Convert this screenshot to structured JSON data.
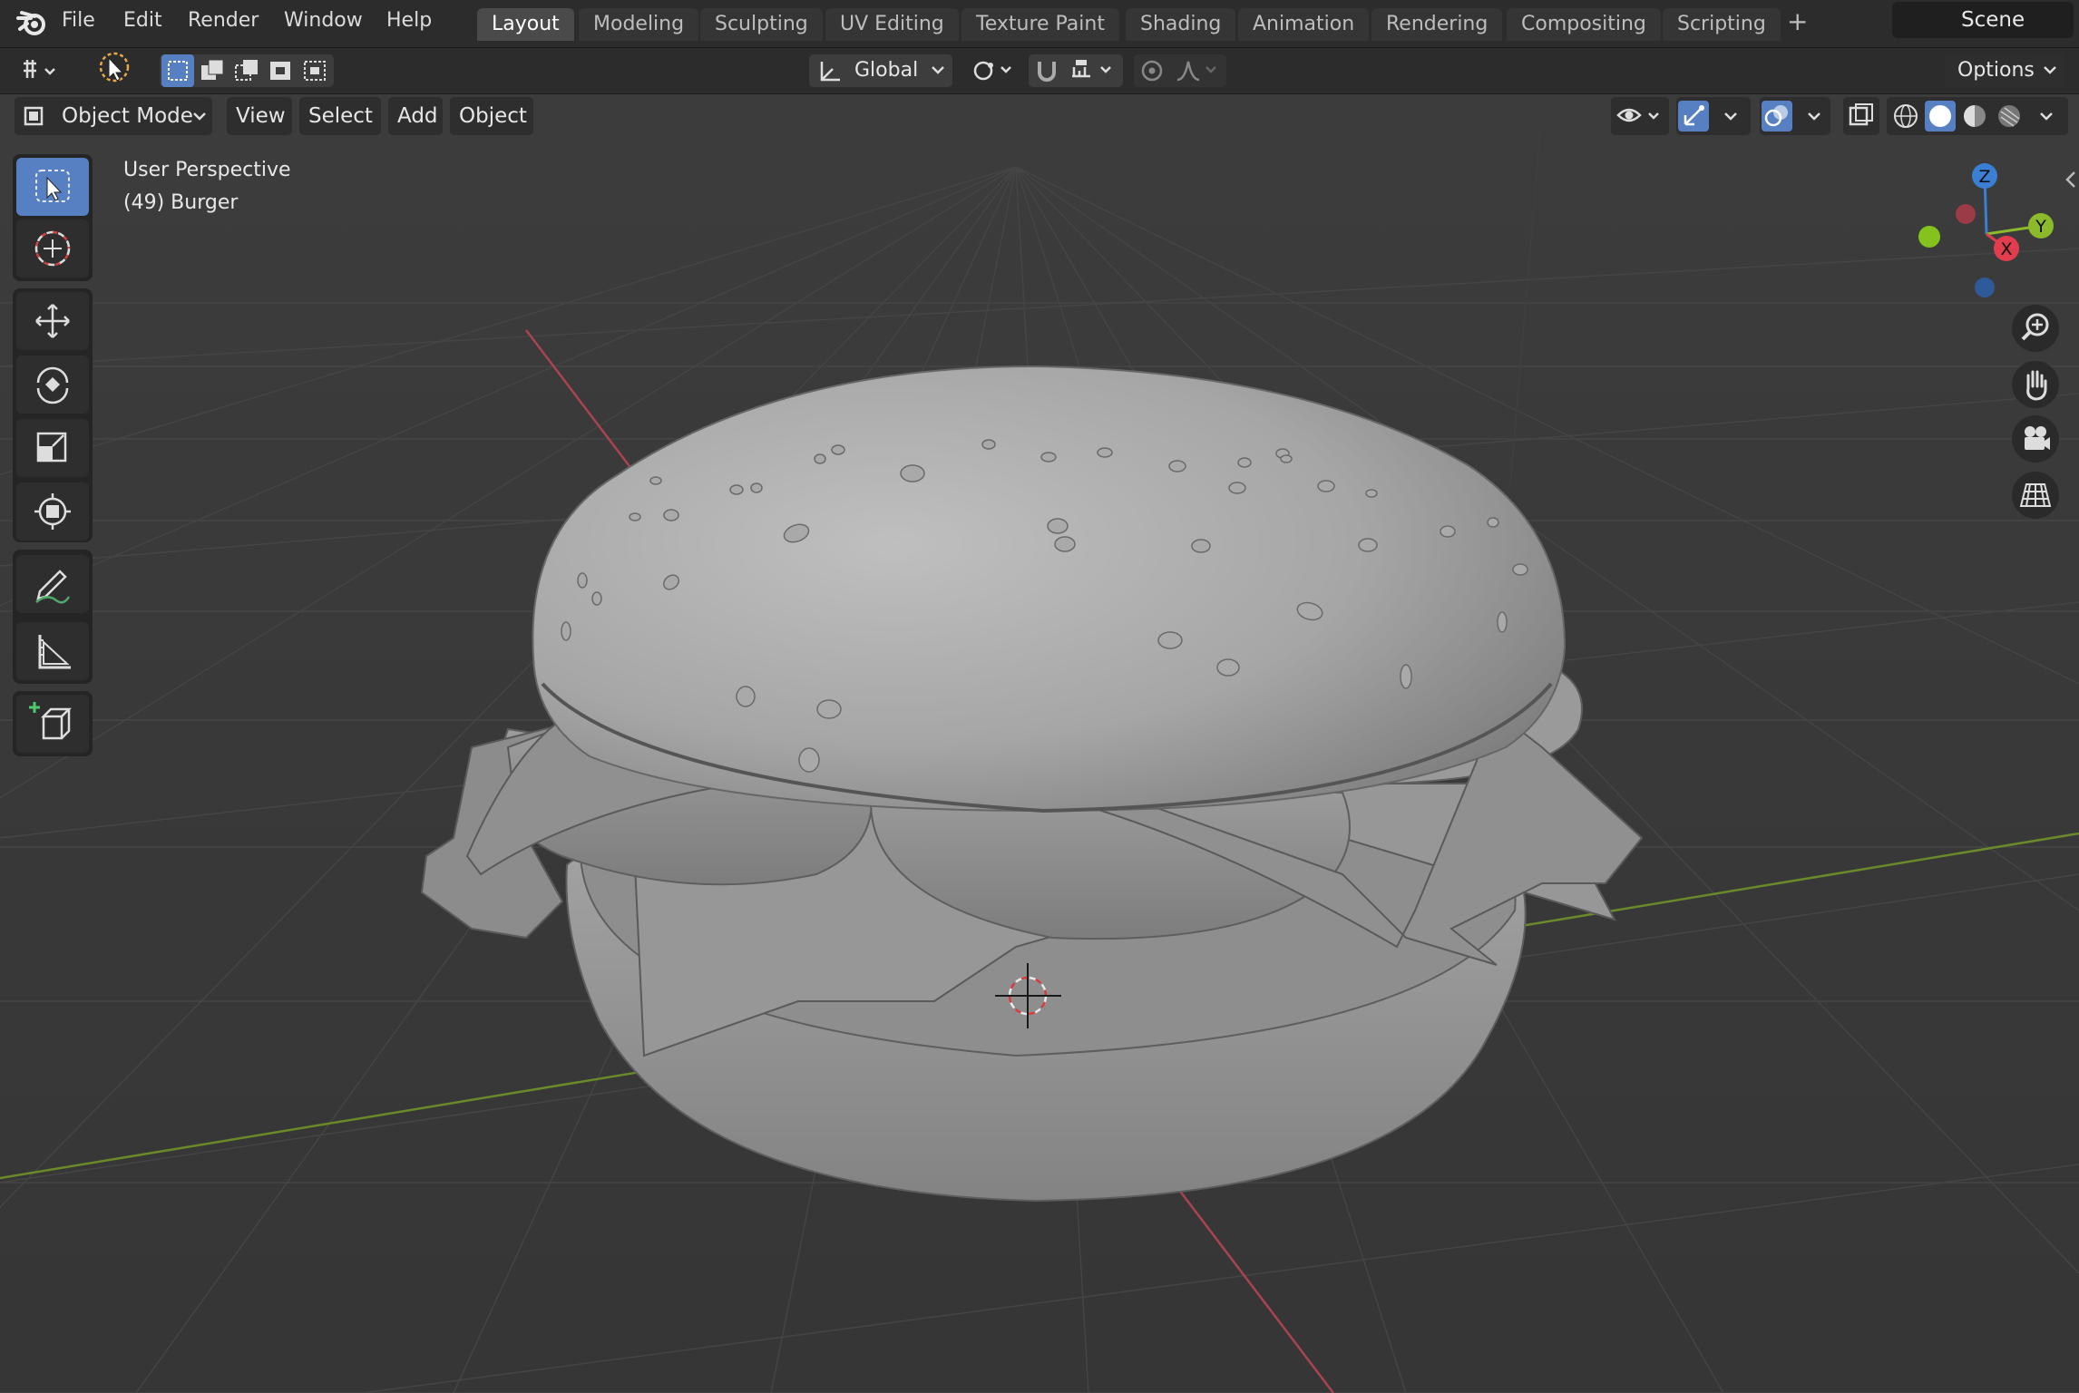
{
  "menu": {
    "items": [
      "File",
      "Edit",
      "Render",
      "Window",
      "Help"
    ]
  },
  "workspaces": {
    "tabs": [
      "Layout",
      "Modeling",
      "Sculpting",
      "UV Editing",
      "Texture Paint",
      "Shading",
      "Animation",
      "Rendering",
      "Compositing",
      "Scripting"
    ],
    "active": "Layout",
    "add_label": "+"
  },
  "scene": {
    "name": "Scene"
  },
  "toolbar": {
    "transform_orientation": "Global",
    "options_label": "Options"
  },
  "header": {
    "mode": "Object Mode",
    "view": "View",
    "select": "Select",
    "add": "Add",
    "object": "Object"
  },
  "viewport": {
    "perspective": "User Perspective",
    "object_info": "(49) Burger"
  },
  "gizmo": {
    "z": "Z",
    "y": "Y",
    "x": "X"
  },
  "colors": {
    "accent": "#5680c2",
    "x_axis": "#e23c4f",
    "y_axis": "#8bbb2b",
    "z_axis": "#3a7fd4"
  }
}
